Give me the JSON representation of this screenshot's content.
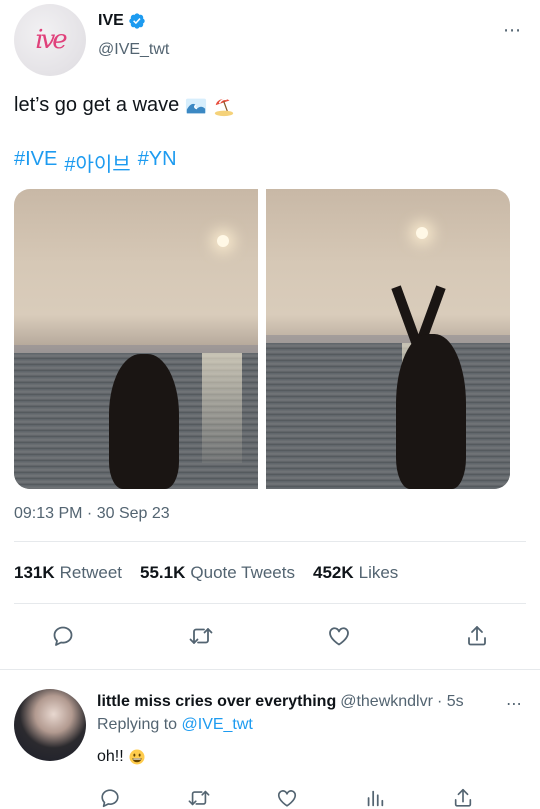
{
  "tweet": {
    "display_name": "IVE",
    "handle": "@IVE_twt",
    "avatar_logo_text": "ive",
    "text": "let’s go get a wave",
    "emojis": [
      "wave-emoji",
      "beach-umbrella-emoji"
    ],
    "hashtags": [
      "#IVE",
      "#아이브",
      "#YN"
    ],
    "timestamp": "09:13 PM · 30 Sep 23",
    "stats": {
      "retweets": {
        "count": "131K",
        "label": "Retweet"
      },
      "quotes": {
        "count": "55.1K",
        "label": "Quote Tweets"
      },
      "likes": {
        "count": "452K",
        "label": "Likes"
      }
    },
    "more_icon": "⋯"
  },
  "actions": [
    "reply-icon",
    "retweet-icon",
    "like-icon",
    "share-icon"
  ],
  "reply": {
    "display_name": "little miss cries over everything",
    "handle": "@thewkndlvr",
    "time": "· 5s",
    "replying_prefix": "Replying to",
    "replying_to": "@IVE_twt",
    "text": "oh!!",
    "emoji": "grinning-face-emoji",
    "more_icon": "⋯",
    "actions": [
      "reply-icon",
      "retweet-icon",
      "like-icon",
      "analytics-icon",
      "share-icon"
    ]
  },
  "colors": {
    "accent": "#1d9bf0",
    "text_primary": "#0f1419",
    "text_secondary": "#536471",
    "divider": "#e6e9ec"
  }
}
